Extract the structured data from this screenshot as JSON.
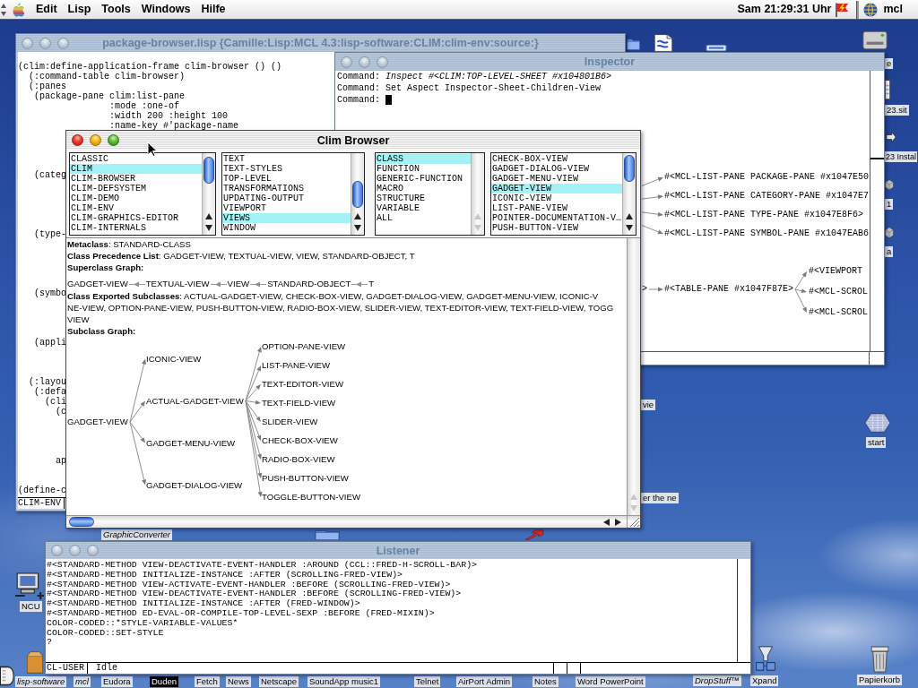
{
  "menu_bar": {
    "menus": [
      "Edit",
      "Lisp",
      "Tools",
      "Windows",
      "Hilfe"
    ],
    "clock": "Sam 21:29:31 Uhr",
    "application": "mcl"
  },
  "desktop_icons": [
    {
      "kind": "folder",
      "selected": false
    },
    {
      "kind": "document",
      "selected": false
    },
    {
      "kind": "drive",
      "selected": false
    },
    {
      "label": "e",
      "kind": "disk",
      "alias": false,
      "selected": false
    },
    {
      "label": "23.sit",
      "kind": "archive",
      "alias": false,
      "selected": false
    },
    {
      "label": "23 Instal",
      "kind": "installer",
      "alias": false,
      "selected": false
    },
    {
      "label": "1",
      "kind": "cube",
      "alias": false,
      "selected": false
    },
    {
      "label": "a",
      "kind": "cube",
      "alias": false,
      "selected": false
    },
    {
      "label": "vie",
      "alias": false,
      "selected": false
    },
    {
      "label": "start",
      "kind": "hexagon",
      "alias": false,
      "selected": false
    },
    {
      "label": "er the ne",
      "alias": false,
      "selected": false
    },
    {
      "label": "GraphicConverter",
      "alias": true,
      "selected": false
    },
    {
      "kind": "folder",
      "selected": false
    },
    {
      "kind": "alias",
      "selected": false
    },
    {
      "label": "NCU",
      "kind": "computer",
      "alias": false,
      "selected": false
    },
    {
      "label": "lisp-software",
      "kind": "box",
      "alias": true,
      "selected": false
    },
    {
      "label": "mcl",
      "alias": true,
      "selected": false
    },
    {
      "label": "Eudora",
      "alias": false,
      "selected": false
    },
    {
      "label": "Duden",
      "alias": false,
      "selected": true
    },
    {
      "label": "Fetch",
      "alias": false,
      "selected": false
    },
    {
      "label": "News",
      "alias": false,
      "selected": false
    },
    {
      "label": "Netscape",
      "alias": false,
      "selected": false
    },
    {
      "label": "SoundApp music1",
      "alias": false,
      "selected": false
    },
    {
      "label": "Telnet",
      "alias": false,
      "selected": false
    },
    {
      "label": "AirPort Admin",
      "alias": false,
      "selected": false
    },
    {
      "label": "Notes",
      "alias": false,
      "selected": false
    },
    {
      "label": "Word PowerPoint",
      "alias": false,
      "selected": false
    },
    {
      "label": "DropStuff™",
      "alias": true,
      "selected": false
    },
    {
      "label": "Xpand",
      "kind": "funnel",
      "alias": false,
      "selected": false
    },
    {
      "label": "Papierkorb",
      "kind": "trash",
      "alias": false,
      "selected": false
    },
    {
      "kind": "script",
      "selected": false
    }
  ],
  "package_browser": {
    "title": "package-browser.lisp {Camille:Lisp:MCL 4.3:lisp-software:CLIM:clim-env:source:}",
    "active": false,
    "code_lines": [
      "(clim:define-application-frame clim-browser () ()",
      "  (:command-table clim-browser)",
      "  (:panes",
      "   (package-pane clim:list-pane",
      "                 :mode :one-of",
      "                 :width 200 :height 100",
      "                 :name-key #'package-name",
      "   (categ",
      "   (type-",
      "   (symbo",
      "   (appli",
      "  (:layou",
      "   (:defa",
      "     (cli",
      "       (c",
      "       ap",
      "(define-c"
    ],
    "package": "CLIM-ENV"
  },
  "inspector": {
    "title": "Inspector",
    "active": false,
    "commands": [
      "Command: *Inspect #<CLIM:TOP-LEVEL-SHEET #x104801B6>*",
      "Command: Set Aspect Inspector-Sheet-Children-View",
      "Command:"
    ],
    "cursor": true,
    "graph": [
      {
        "children": [
          {
            "label": "#<MCL-LIST-PANE PACKAGE-PANE #x1047E50"
          },
          {
            "label": "#<MCL-LIST-PANE CATEGORY-PANE #x1047E7"
          },
          {
            "label": "#<MCL-LIST-PANE TYPE-PANE #x1047E8F6>"
          },
          {
            "label": "#<MCL-LIST-PANE SYMBOL-PANE #x1047EAB6"
          }
        ]
      },
      {
        "label": ">",
        "children": [
          {
            "label": "#<TABLE-PANE #x1047F87E>",
            "children": [
              {
                "label": "#<VIEWPORT"
              },
              {
                "label": "#<MCL-SCROL"
              },
              {
                "label": "#<MCL-SCROL"
              }
            ]
          }
        ]
      }
    ]
  },
  "clim_browser": {
    "title": "Clim Browser",
    "active": true,
    "lists": [
      {
        "scrollable": true,
        "items": [
          {
            "label": "CLASSIC",
            "selected": false
          },
          {
            "label": "CLIM",
            "selected": true
          },
          {
            "label": "CLIM-BROWSER",
            "selected": false
          },
          {
            "label": "CLIM-DEFSYSTEM",
            "selected": false
          },
          {
            "label": "CLIM-DEMO",
            "selected": false
          },
          {
            "label": "CLIM-ENV",
            "selected": false
          },
          {
            "label": "CLIM-GRAPHICS-EDITOR",
            "selected": false
          },
          {
            "label": "CLIM-INTERNALS",
            "selected": false
          }
        ]
      },
      {
        "scrollable": true,
        "items": [
          {
            "label": "TEXT",
            "selected": false
          },
          {
            "label": "TEXT-STYLES",
            "selected": false
          },
          {
            "label": "TOP-LEVEL",
            "selected": false
          },
          {
            "label": "TRANSFORMATIONS",
            "selected": false
          },
          {
            "label": "UPDATING-OUTPUT",
            "selected": false
          },
          {
            "label": "VIEWPORT",
            "selected": false
          },
          {
            "label": "VIEWS",
            "selected": true
          },
          {
            "label": "WINDOW",
            "selected": false
          }
        ]
      },
      {
        "scrollable": false,
        "items": [
          {
            "label": "CLASS",
            "selected": true
          },
          {
            "label": "FUNCTION",
            "selected": false
          },
          {
            "label": "GENERIC-FUNCTION",
            "selected": false
          },
          {
            "label": "MACRO",
            "selected": false
          },
          {
            "label": "STRUCTURE",
            "selected": false
          },
          {
            "label": "VARIABLE",
            "selected": false
          },
          {
            "label": "ALL",
            "selected": false
          }
        ]
      },
      {
        "scrollable": true,
        "items": [
          {
            "label": "CHECK-BOX-VIEW",
            "selected": false
          },
          {
            "label": "GADGET-DIALOG-VIEW",
            "selected": false
          },
          {
            "label": "GADGET-MENU-VIEW",
            "selected": false
          },
          {
            "label": "GADGET-VIEW",
            "selected": true
          },
          {
            "label": "ICONIC-VIEW",
            "selected": false
          },
          {
            "label": "LIST-PANE-VIEW",
            "selected": false
          },
          {
            "label": "POINTER-DOCUMENTATION-V…",
            "selected": false
          },
          {
            "label": "PUSH-BUTTON-VIEW",
            "selected": false
          }
        ]
      }
    ],
    "info": {
      "metaclass": "**Metaclass**: STANDARD-CLASS",
      "precedence": "**Class Precedence List**: GADGET-VIEW, TEXTUAL-VIEW, VIEW, STANDARD-OBJECT, T",
      "superclass_graph": {
        "heading": "Superclass Graph:",
        "nodes": [
          "GADGET-VIEW",
          "TEXTUAL-VIEW",
          "VIEW",
          "STANDARD-OBJECT",
          "T"
        ]
      },
      "exported_subclasses": [
        "**Class Exported Subclasses**: ACTUAL-GADGET-VIEW, CHECK-BOX-VIEW, GADGET-DIALOG-VIEW, GADGET-MENU-VIEW, ICONIC-V",
        "NE-VIEW, OPTION-PANE-VIEW, PUSH-BUTTON-VIEW, RADIO-BOX-VIEW, SLIDER-VIEW, TEXT-EDITOR-VIEW, TEXT-FIELD-VIEW, TOGG",
        "VIEW"
      ],
      "subclass_graph": {
        "heading": "Subclass Graph:",
        "root": {
          "label": "GADGET-VIEW",
          "children": [
            {
              "label": "ICONIC-VIEW"
            },
            {
              "label": "ACTUAL-GADGET-VIEW",
              "children": [
                {
                  "label": "OPTION-PANE-VIEW"
                },
                {
                  "label": "LIST-PANE-VIEW"
                },
                {
                  "label": "TEXT-EDITOR-VIEW"
                },
                {
                  "label": "TEXT-FIELD-VIEW"
                },
                {
                  "label": "SLIDER-VIEW"
                },
                {
                  "label": "CHECK-BOX-VIEW"
                },
                {
                  "label": "RADIO-BOX-VIEW"
                },
                {
                  "label": "PUSH-BUTTON-VIEW"
                },
                {
                  "label": "TOGGLE-BUTTON-VIEW"
                }
              ]
            },
            {
              "label": "GADGET-MENU-VIEW"
            },
            {
              "label": "GADGET-DIALOG-VIEW"
            }
          ]
        }
      }
    }
  },
  "listener": {
    "title": "Listener",
    "active": false,
    "lines": [
      "#<STANDARD-METHOD VIEW-DEACTIVATE-EVENT-HANDLER :AROUND (CCL::FRED-H-SCROLL-BAR)>",
      "#<STANDARD-METHOD INITIALIZE-INSTANCE :AFTER (SCROLLING-FRED-VIEW)>",
      "#<STANDARD-METHOD VIEW-ACTIVATE-EVENT-HANDLER :BEFORE (SCROLLING-FRED-VIEW)>",
      "#<STANDARD-METHOD VIEW-DEACTIVATE-EVENT-HANDLER :BEFORE (SCROLLING-FRED-VIEW)>",
      "#<STANDARD-METHOD INITIALIZE-INSTANCE :AFTER (FRED-WINDOW)>",
      "#<STANDARD-METHOD ED-EVAL-OR-COMPILE-TOP-LEVEL-SEXP :BEFORE (FRED-MIXIN)>",
      "COLOR-CODED::*STYLE-VARIABLE-VALUES*",
      "COLOR-CODED::SET-STYLE",
      "?"
    ],
    "package": "CL-USER",
    "status": "Idle"
  }
}
